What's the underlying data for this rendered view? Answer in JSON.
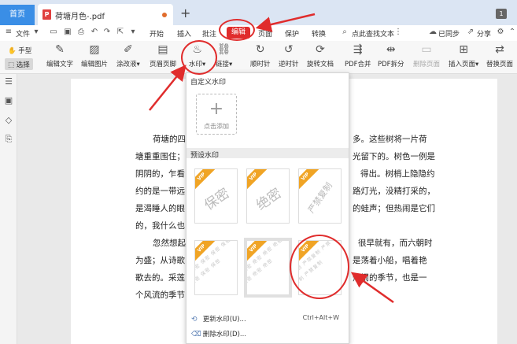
{
  "tabs": {
    "home": "首页",
    "doc_icon": "P",
    "doc_title": "荷塘月色-.pdf",
    "new_tab": "+",
    "badge": "1"
  },
  "menu": {
    "file": "文件",
    "start": "开始",
    "insert": "插入",
    "annotate": "批注",
    "edit": "编辑",
    "page": "页面",
    "protect": "保护",
    "convert": "转换",
    "search": "点此查找文本",
    "sync": "已同步",
    "share": "分享"
  },
  "ribbon": {
    "hand": "手型",
    "select": "选择",
    "edit_text": "编辑文字",
    "edit_image": "编辑图片",
    "correction": "涂改液",
    "header_footer": "页眉页脚",
    "watermark": "水印",
    "link": "链接",
    "clockwise": "顺时针",
    "counterclockwise": "逆时针",
    "rotate": "旋转文档",
    "merge": "PDF合并",
    "split": "PDF拆分",
    "delete_page": "删除页面",
    "insert_page": "插入页面",
    "replace_page": "替换页面"
  },
  "document": {
    "lines": [
      "荷塘的四",
      "塘重重围住；",
      "阴阴的，乍看",
      "约的是一带远",
      "是渴睡人的眼",
      "的，我什么也",
      "忽然想起",
      "为盛；从诗歌",
      "歌去的。采莲",
      "个风流的季节"
    ],
    "right_lines": [
      "多。这些树将一片荷",
      "光留下的。树色一例是",
      "得出。树梢上隐隐约",
      "路灯光，没精打采的，",
      "的蛙声；但热闹是它们",
      "很早就有，而六朝时",
      "是荡着小船，唱着艳",
      "热闹的季节，也是一"
    ]
  },
  "watermark_menu": {
    "custom_title": "自定义水印",
    "add_label": "点击添加",
    "preset_title": "预设水印",
    "tiles": [
      {
        "text": "保密",
        "badge": "VIP"
      },
      {
        "text": "绝密",
        "badge": "VIP"
      },
      {
        "text": "严禁复制",
        "badge": "VIP"
      },
      {
        "text": "保密 保密 保密 保密 保密 保密 保密 保密 保密 保密 保密 保密",
        "badge": "VIP"
      },
      {
        "text": "绝密 绝密 绝密 绝密 绝密 绝密 绝密 绝密 绝密 绝密 绝密 绝密",
        "badge": "VIP"
      },
      {
        "text": "严禁复制 严禁复制 严禁复制 严禁复制 严禁复制 严禁复制",
        "badge": "VIP"
      }
    ],
    "update_label": "更新水印(U)...",
    "update_shortcut": "Ctrl+Alt+W",
    "delete_label": "删除水印(D)..."
  },
  "colors": {
    "accent": "#3a8ee6",
    "edit_tab": "#e02c2c",
    "annotation": "#e02c2c",
    "vip": "#f0a425"
  }
}
